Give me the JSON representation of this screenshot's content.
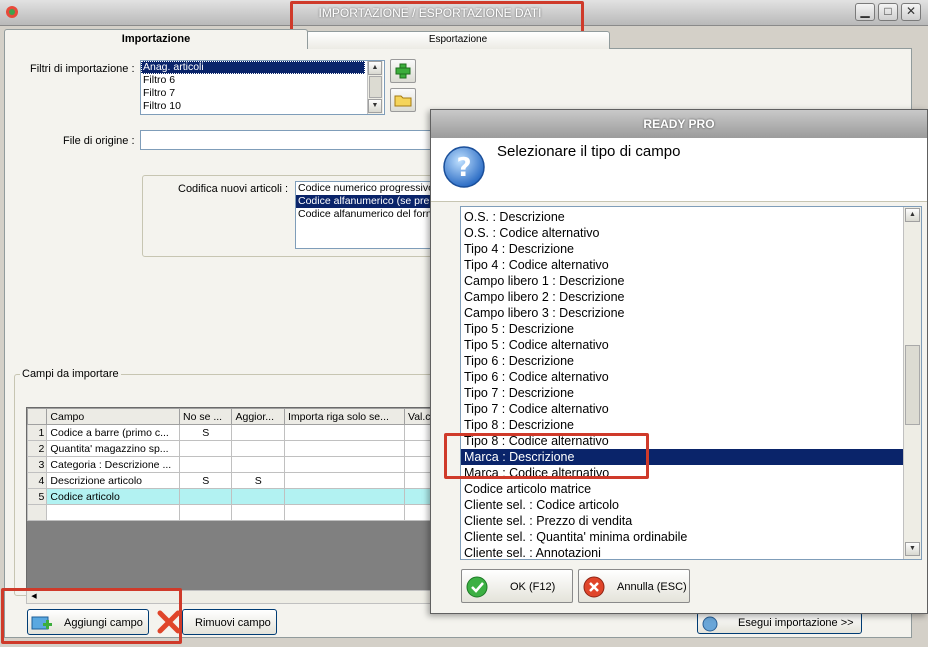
{
  "window": {
    "title": "IMPORTAZIONE / ESPORTAZIONE DATI",
    "minimize_glyph": "▁",
    "maximize_glyph": "□",
    "close_glyph": "✕"
  },
  "tabs": [
    {
      "label": "Importazione",
      "active": true
    },
    {
      "label": "Esportazione",
      "active": false
    }
  ],
  "filters": {
    "label": "Filtri di importazione :",
    "items": [
      "Anag. articoli",
      "Filtro 6",
      "Filtro 7",
      "Filtro 10"
    ],
    "selected_index": 0
  },
  "file_origin": {
    "label": "File di origine :",
    "value": ""
  },
  "codifica": {
    "label": "Codifica nuovi articoli :",
    "items": [
      "Codice numerico progressivo",
      "Codice alfanumerico (se pre",
      "Codice alfanumerico del forn"
    ],
    "selected_index": 1
  },
  "fields_group": {
    "title": "Campi da importare"
  },
  "grid": {
    "columns": [
      "Campo",
      "No se ...",
      "Aggior...",
      "Importa riga solo se...",
      "Val.c"
    ],
    "rows": [
      {
        "num": "1",
        "cells": [
          "Codice a barre (primo c...",
          "S",
          "",
          "",
          ""
        ]
      },
      {
        "num": "2",
        "cells": [
          "Quantita' magazzino sp...",
          "",
          "",
          "",
          ""
        ]
      },
      {
        "num": "3",
        "cells": [
          "Categoria : Descrizione ...",
          "",
          "",
          "",
          ""
        ]
      },
      {
        "num": "4",
        "cells": [
          "Descrizione articolo",
          "S",
          "S",
          "",
          ""
        ]
      },
      {
        "num": "5",
        "cells": [
          "Codice articolo",
          "",
          "",
          "",
          ""
        ]
      }
    ],
    "current_row": 4
  },
  "buttons": {
    "add_field": "Aggiungi campo",
    "remove_field": "Rimuovi campo",
    "run_import": "Esegui importazione >>"
  },
  "dialog": {
    "title": "READY PRO",
    "prompt": "Selezionare il tipo di campo",
    "items": [
      "O.S. : Descrizione",
      "O.S. : Codice alternativo",
      "Tipo 4 : Descrizione",
      "Tipo 4 : Codice alternativo",
      "Campo libero 1 : Descrizione",
      "Campo libero 2 : Descrizione",
      "Campo libero 3 : Descrizione",
      "Tipo 5 : Descrizione",
      "Tipo 5 : Codice alternativo",
      "Tipo 6 : Descrizione",
      "Tipo 6 : Codice alternativo",
      "Tipo 7 : Descrizione",
      "Tipo 7 : Codice alternativo",
      "Tipo 8 : Descrizione",
      "Tipo 8 : Codice alternativo",
      "Marca : Descrizione",
      "Marca : Codice alternativo",
      "Codice articolo matrice",
      "Cliente sel. : Codice articolo",
      "Cliente sel. : Prezzo di vendita",
      "Cliente sel. : Quantita' minima ordinabile",
      "Cliente sel. : Annotazioni"
    ],
    "selected_index": 15,
    "ok_label": "OK (F12)",
    "cancel_label": "Annulla (ESC)"
  },
  "colors": {
    "selection": "#0a246a",
    "highlight_box": "#cf3a2a",
    "current_row": "#b2f2f2"
  }
}
